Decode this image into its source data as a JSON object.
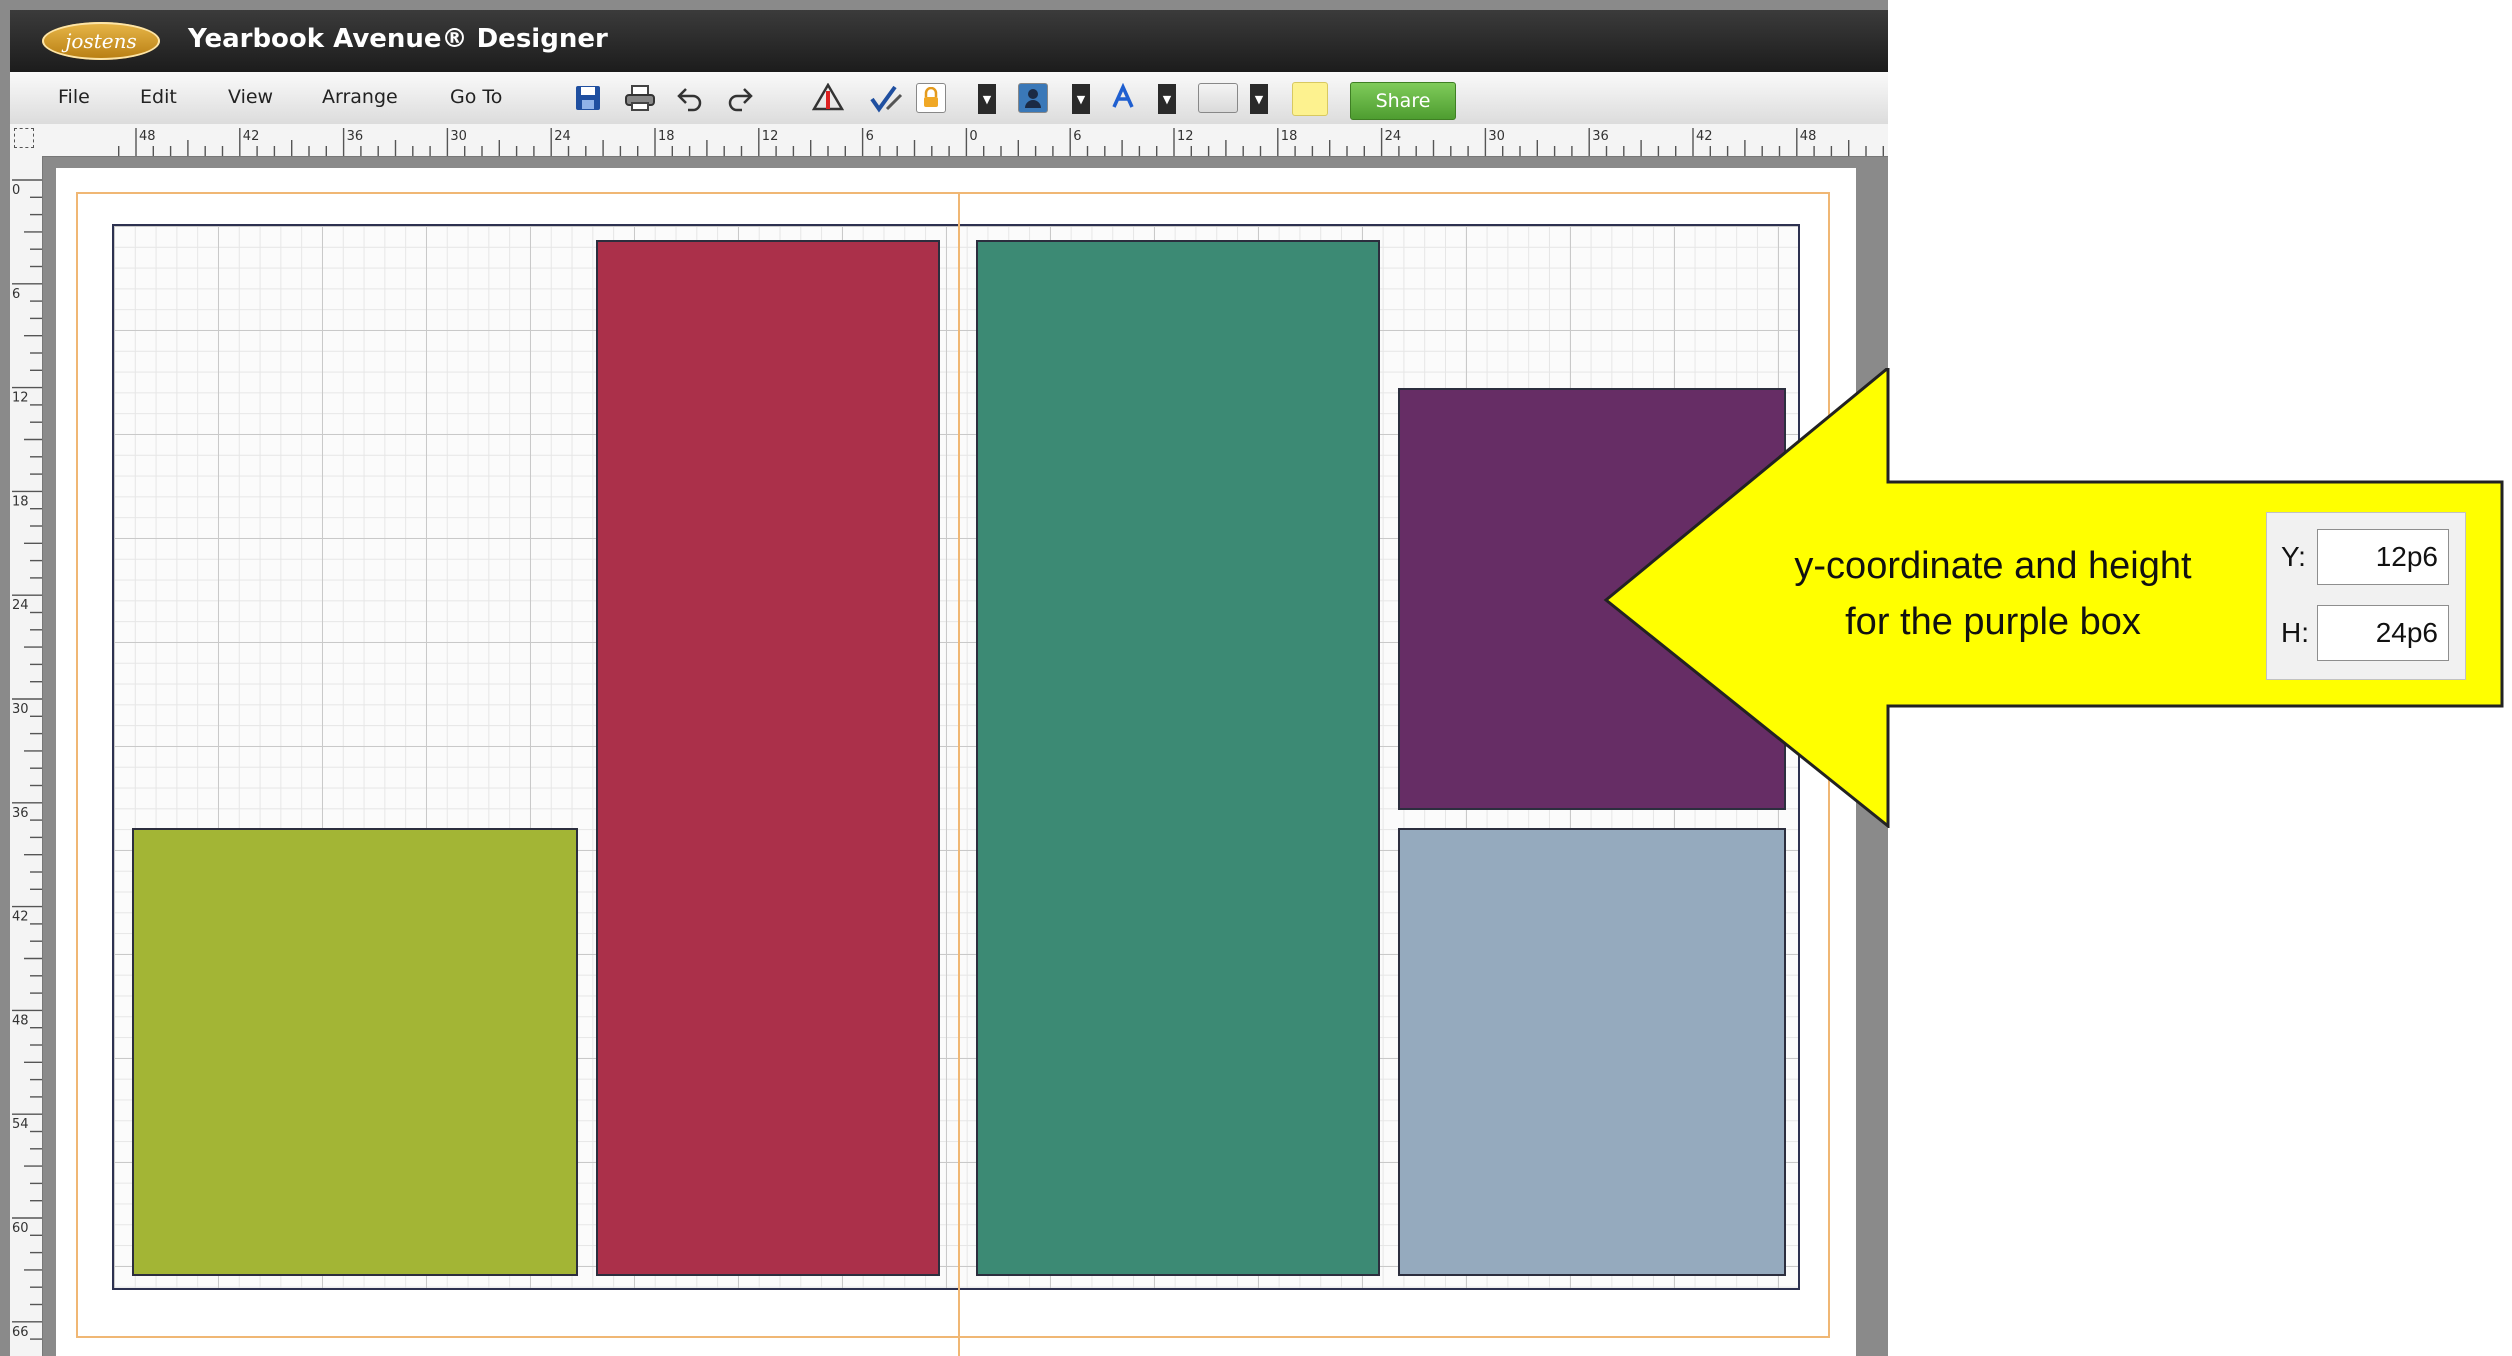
{
  "app": {
    "logo_text": "jostens",
    "title": "Yearbook Avenue® Designer"
  },
  "menu": {
    "items": [
      "File",
      "Edit",
      "View",
      "Arrange",
      "Go To"
    ]
  },
  "toolbar": {
    "icons": [
      "save-icon",
      "print-icon",
      "undo-icon",
      "redo-icon",
      "flag-icon",
      "check-pen-icon",
      "lock-icon",
      "person-icon",
      "text-color-icon",
      "fill-color-icon",
      "sticky-note-icon"
    ],
    "share_label": "Share"
  },
  "rulers": {
    "horizontal_labels": [
      "48",
      "42",
      "36",
      "30",
      "24",
      "18",
      "12",
      "6",
      "0",
      "6",
      "12",
      "18",
      "24",
      "30",
      "36",
      "42",
      "48"
    ],
    "vertical_labels": [
      "0",
      "6",
      "12",
      "18",
      "24",
      "30",
      "36",
      "42",
      "48",
      "54",
      "60",
      "66"
    ]
  },
  "shapes": [
    {
      "name": "green-box",
      "color": "#a3b535"
    },
    {
      "name": "red-box",
      "color": "#ab304a"
    },
    {
      "name": "teal-box",
      "color": "#3c8a74"
    },
    {
      "name": "purple-box",
      "color": "#662d65"
    },
    {
      "name": "blue-gray-box",
      "color": "#95aabe"
    }
  ],
  "callout": {
    "line1": "y-coordinate and height",
    "line2": "for the purple box",
    "color": "#ffff00"
  },
  "properties": {
    "y_label": "Y:",
    "y_value": "12p6",
    "h_label": "H:",
    "h_value": "24p6"
  }
}
